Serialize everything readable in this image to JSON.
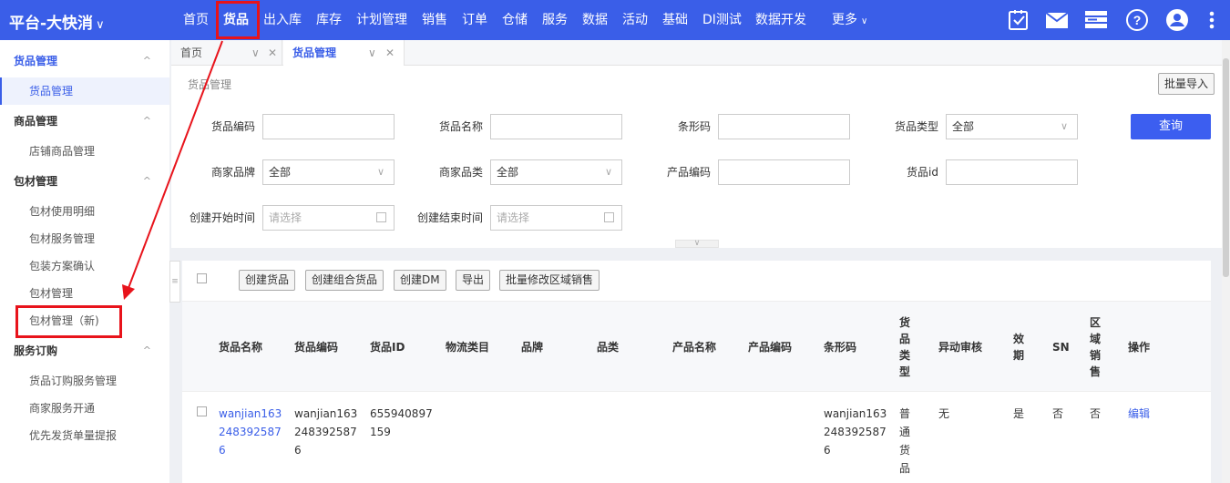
{
  "app": {
    "brand": "平台-大快消"
  },
  "top_nav": [
    "首页",
    "货品",
    "出入库",
    "库存",
    "计划管理",
    "销售",
    "订单",
    "仓储",
    "服务",
    "数据",
    "活动",
    "基础",
    "DI测试",
    "数据开发",
    "更多"
  ],
  "sidebar": {
    "groups": [
      {
        "title": "货品管理",
        "items": [
          "货品管理"
        ]
      },
      {
        "title": "商品管理",
        "items": [
          "店铺商品管理"
        ]
      },
      {
        "title": "包材管理",
        "items": [
          "包材使用明细",
          "包材服务管理",
          "包装方案确认",
          "包材管理",
          "包材管理（新)"
        ]
      },
      {
        "title": "服务订购",
        "items": [
          "货品订购服务管理",
          "商家服务开通",
          "优先发货单量提报"
        ]
      }
    ]
  },
  "tabs": [
    "首页",
    "货品管理"
  ],
  "breadcrumb": "货品管理",
  "import_button": "批量导入",
  "filters": {
    "goods_code": {
      "label": "货品编码",
      "value": ""
    },
    "goods_name": {
      "label": "货品名称",
      "value": ""
    },
    "barcode": {
      "label": "条形码",
      "value": ""
    },
    "goods_type": {
      "label": "货品类型",
      "value": "全部"
    },
    "merchant_brand": {
      "label": "商家品牌",
      "value": "全部"
    },
    "merchant_category": {
      "label": "商家品类",
      "value": "全部"
    },
    "product_code": {
      "label": "产品编码",
      "value": ""
    },
    "goods_id": {
      "label": "货品id",
      "value": ""
    },
    "create_start": {
      "label": "创建开始时间",
      "placeholder": "请选择"
    },
    "create_end": {
      "label": "创建结束时间",
      "placeholder": "请选择"
    }
  },
  "query_button": "查询",
  "toolbar": [
    "创建货品",
    "创建组合货品",
    "创建DM",
    "导出",
    "批量修改区域销售"
  ],
  "table": {
    "columns": [
      "货品名称",
      "货品编码",
      "货品ID",
      "物流类目",
      "品牌",
      "品类",
      "产品名称",
      "产品编码",
      "条形码",
      "货\n品\n类\n型",
      "异动审核",
      "效\n期",
      "SN",
      "区\n域\n销\n售",
      "操作"
    ],
    "rows": [
      {
        "name": "wanjian163\n248392587\n6",
        "code": "wanjian163\n248392587\n6",
        "id": "655940897\n159",
        "logistics": "",
        "brand": "",
        "category": "",
        "product_name": "",
        "product_code": "",
        "barcode": "wanjian163\n248392587\n6",
        "type": "普\n通\n货\n品",
        "audit": "无",
        "expiry": "是",
        "sn": "否",
        "region": "否",
        "action": "编辑"
      }
    ]
  },
  "colors": {
    "topbar": "#3a5ee8",
    "accent": "#3c5ef0",
    "highlight": "#e8131b"
  }
}
